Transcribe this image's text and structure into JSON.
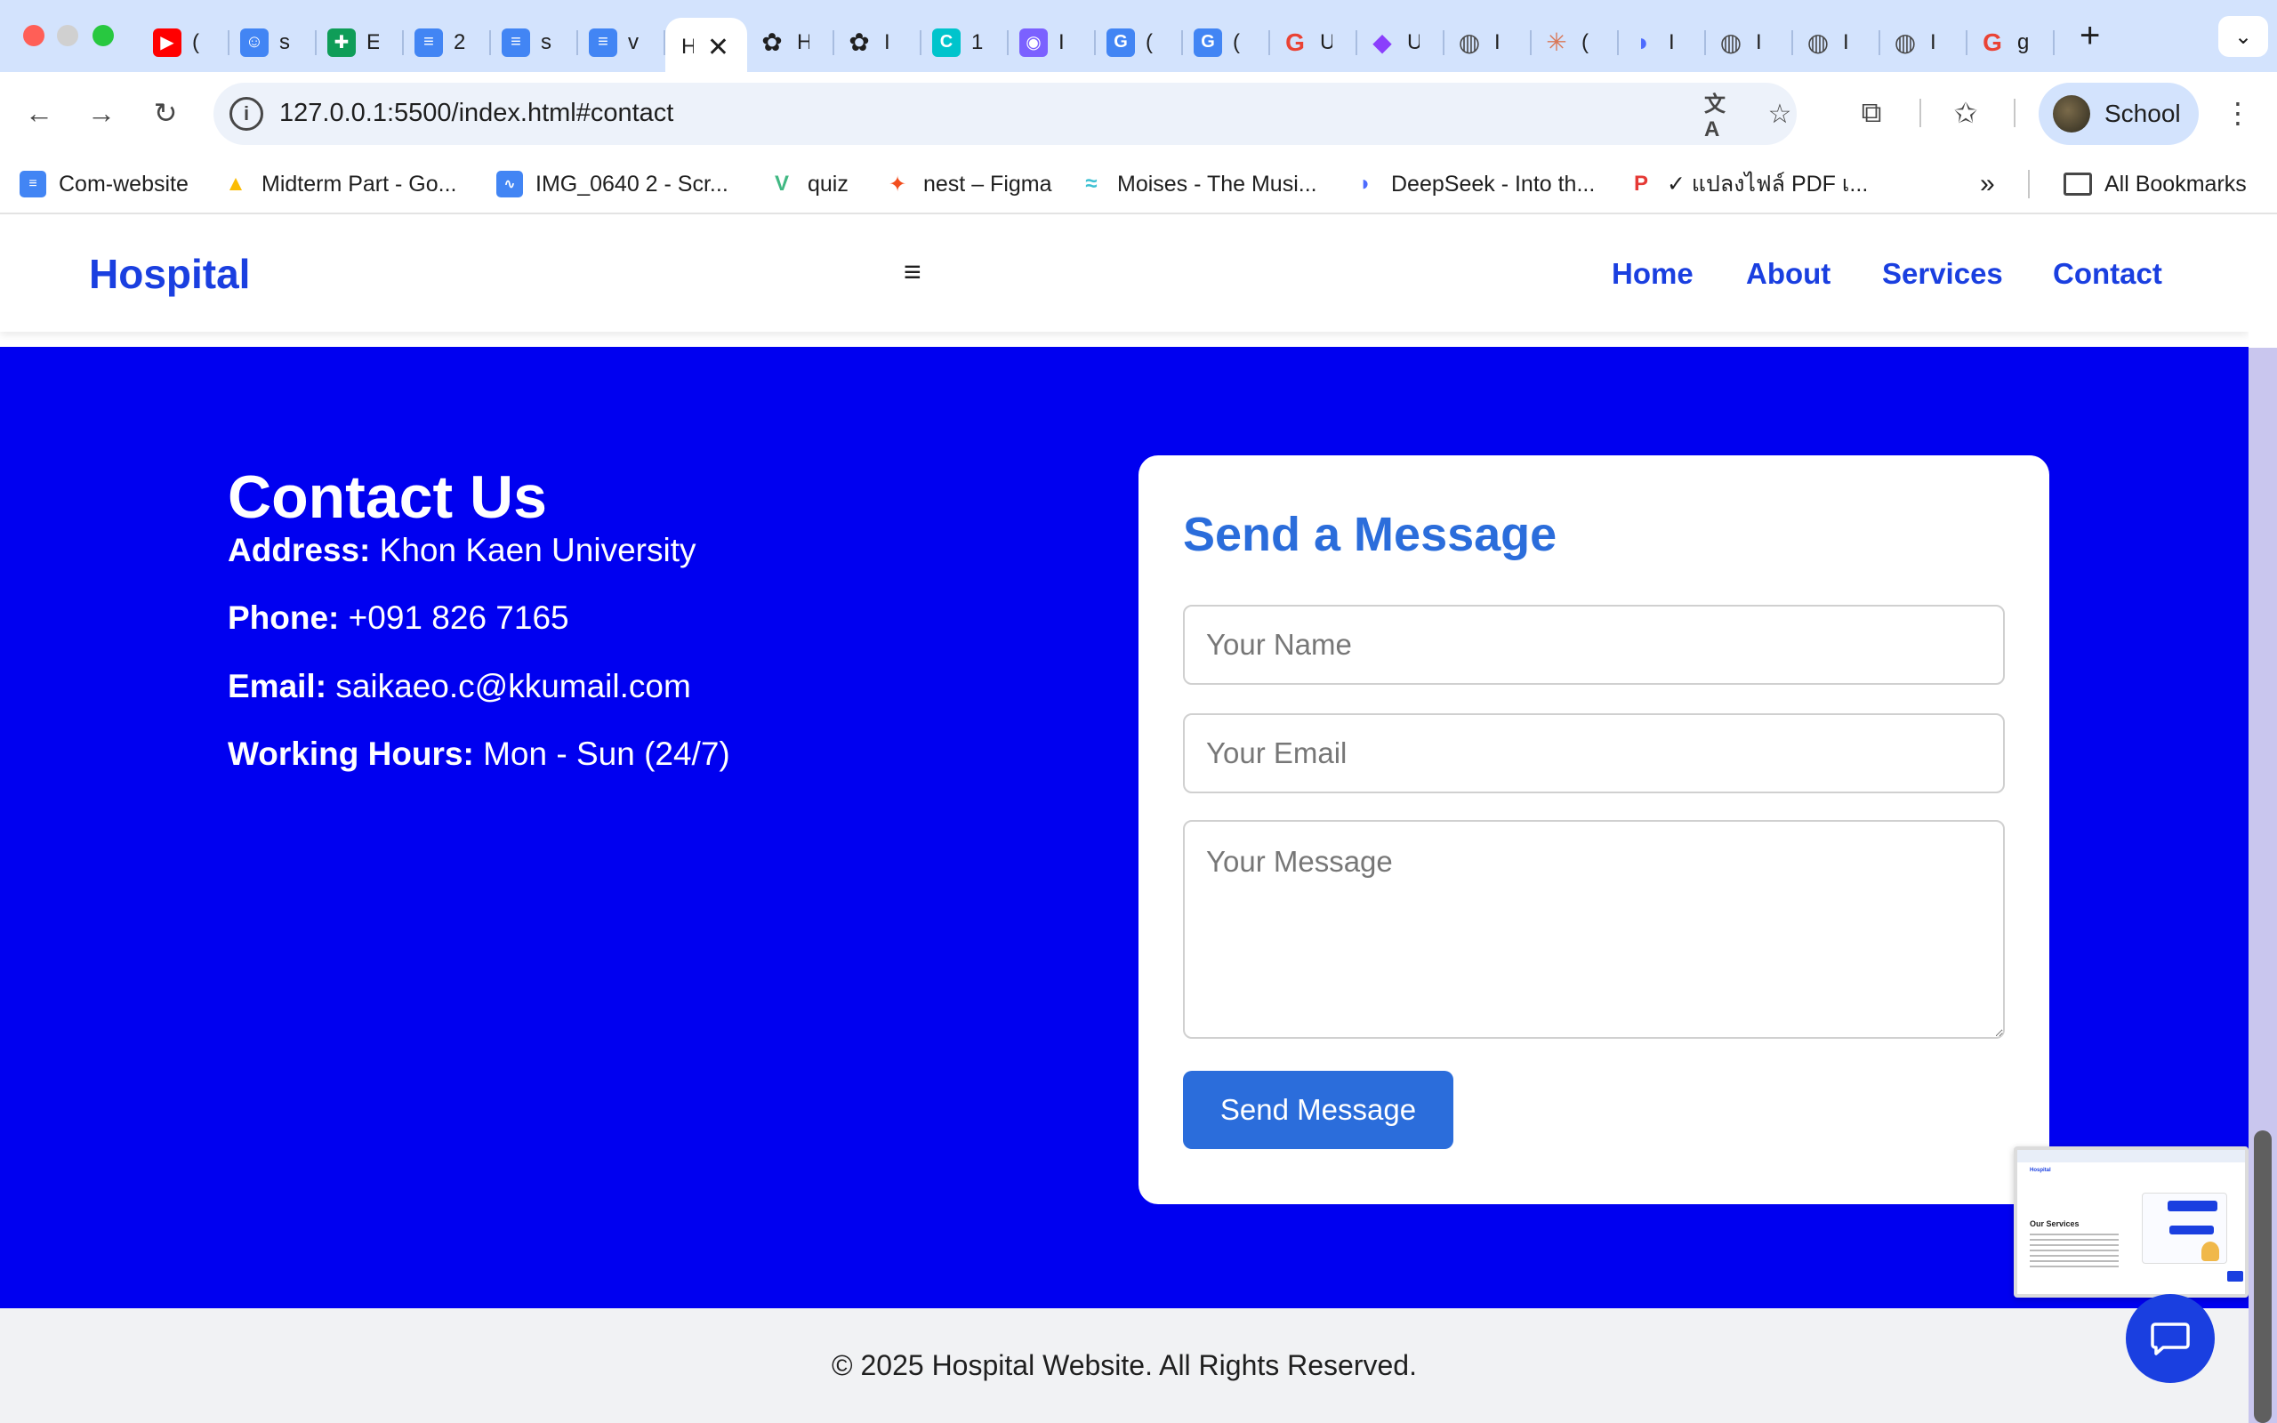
{
  "window": {
    "traffic_lights": [
      "close",
      "minimize",
      "zoom"
    ]
  },
  "tabs": [
    {
      "icon": "youtube-icon",
      "color": "#ff0000",
      "label": "("
    },
    {
      "icon": "contact-card-icon",
      "color": "#4285f4",
      "label": "s"
    },
    {
      "icon": "sheets-icon",
      "color": "#0f9d58",
      "label": "E"
    },
    {
      "icon": "docs-icon",
      "color": "#4285f4",
      "label": "2"
    },
    {
      "icon": "docs-icon",
      "color": "#4285f4",
      "label": "s"
    },
    {
      "icon": "docs-icon",
      "color": "#4285f4",
      "label": "v"
    },
    {
      "icon": "chatgpt-icon",
      "color": "#1f1f1f",
      "label": "H"
    },
    {
      "icon": "chatgpt-icon",
      "color": "#1f1f1f",
      "label": "I"
    },
    {
      "icon": "canva-icon",
      "color": "#00c4cc",
      "label": "1"
    },
    {
      "icon": "podcast-icon",
      "color": "#7b61ff",
      "label": "I"
    },
    {
      "icon": "translate-icon",
      "color": "#4285f4",
      "label": "("
    },
    {
      "icon": "translate-icon",
      "color": "#4285f4",
      "label": "("
    },
    {
      "icon": "google-icon",
      "color": "#ea4335",
      "label": "U"
    },
    {
      "icon": "app-icon",
      "color": "#8a3ffc",
      "label": "U"
    },
    {
      "icon": "globe-icon",
      "color": "#474747",
      "label": "I"
    },
    {
      "icon": "claude-icon",
      "color": "#d97757",
      "label": "("
    },
    {
      "icon": "deepseek-icon",
      "color": "#4d6bfe",
      "label": "I"
    },
    {
      "icon": "globe-icon",
      "color": "#474747",
      "label": "I"
    },
    {
      "icon": "globe-icon",
      "color": "#474747",
      "label": "I"
    },
    {
      "icon": "globe-icon",
      "color": "#474747",
      "label": "I"
    },
    {
      "icon": "google-icon",
      "color": "#ea4335",
      "label": "g"
    }
  ],
  "active_tab": {
    "label": "H",
    "close": "✕"
  },
  "toolbar": {
    "url": "127.0.0.1:5500/index.html#contact",
    "profile_label": "School"
  },
  "bookmarks": [
    {
      "label": "Com-website",
      "icon": "docs-icon",
      "color": "#4285f4"
    },
    {
      "label": "Midterm Part - Go...",
      "icon": "drive-icon",
      "color": "#fbbc04"
    },
    {
      "label": "IMG_0640 2 - Scr...",
      "icon": "audio-icon",
      "color": "#4285f4"
    },
    {
      "label": "quiz",
      "icon": "vue-icon",
      "color": "#41b883"
    },
    {
      "label": "nest – Figma",
      "icon": "figma-icon",
      "color": "#f24e1e"
    },
    {
      "label": "Moises - The Musi...",
      "icon": "wave-icon",
      "color": "#3ec1d3"
    },
    {
      "label": "DeepSeek - Into th...",
      "icon": "deepseek-icon",
      "color": "#4d6bfe"
    },
    {
      "label": "✓ แปลงไฟล์ PDF เ...",
      "icon": "pdf24-icon",
      "color": "#e53935"
    }
  ],
  "bookmarks_overflow": "»",
  "all_bookmarks": "All Bookmarks",
  "site": {
    "logo": "Hospital",
    "menu_glyph": "≡",
    "nav": [
      "Home",
      "About",
      "Services",
      "Contact"
    ]
  },
  "contact": {
    "title": "Contact Us",
    "info": [
      {
        "label": "Address:",
        "value": "Khon Kaen University"
      },
      {
        "label": "Phone:",
        "value": "+091 826 7165"
      },
      {
        "label": "Email:",
        "value": "saikaeo.c@kkumail.com"
      },
      {
        "label": "Working Hours:",
        "value": "Mon - Sun (24/7)"
      }
    ],
    "form": {
      "title": "Send a Message",
      "name_placeholder": "Your Name",
      "email_placeholder": "Your Email",
      "message_placeholder": "Your Message",
      "button": "Send Message"
    }
  },
  "footer": {
    "text": "© 2025 Hospital Website. All Rights Reserved."
  },
  "preview": {
    "heading": "Our Services"
  },
  "colors": {
    "brand_blue": "#1a3fe0",
    "section_bg": "#0000f0",
    "form_accent": "#2b6ddb",
    "tabstrip_bg": "#d3e3fd"
  }
}
